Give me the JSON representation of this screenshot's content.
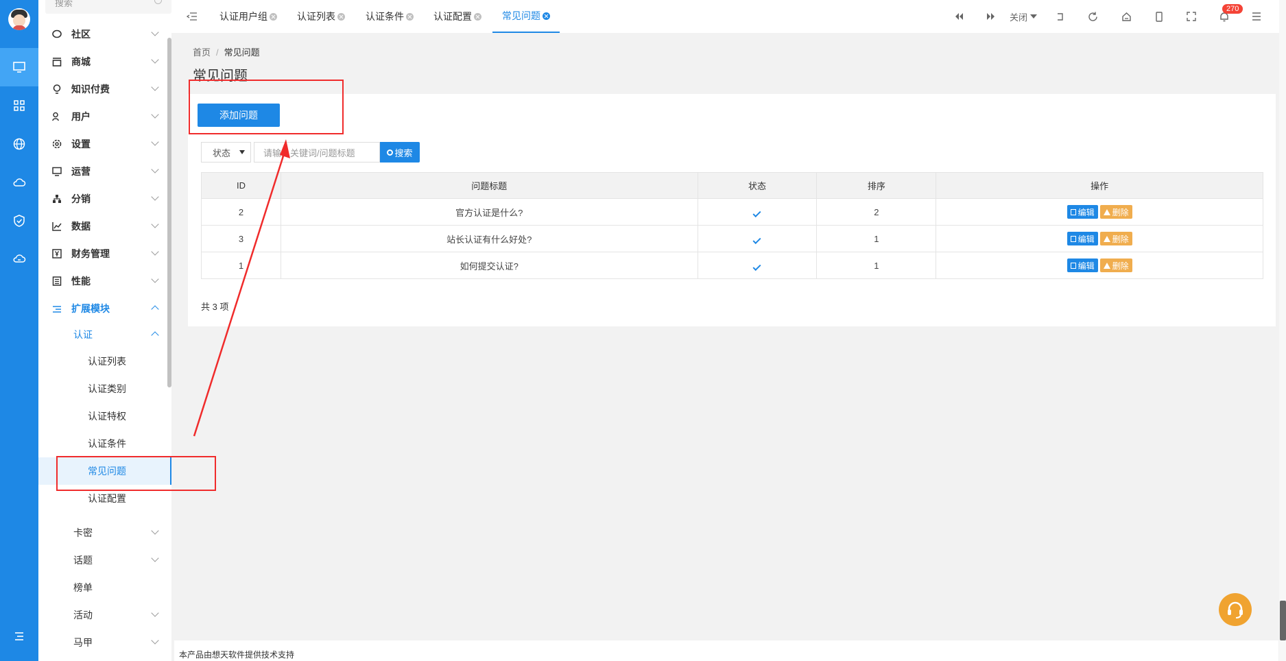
{
  "menu": {
    "search_placeholder": "搜索",
    "items": [
      {
        "label": "社区",
        "icon": "chat-icon"
      },
      {
        "label": "商城",
        "icon": "shop-icon"
      },
      {
        "label": "知识付费",
        "icon": "bulb-icon"
      },
      {
        "label": "用户",
        "icon": "users-icon"
      },
      {
        "label": "设置",
        "icon": "gear-icon"
      },
      {
        "label": "运营",
        "icon": "monitor-icon"
      },
      {
        "label": "分销",
        "icon": "network-icon"
      },
      {
        "label": "数据",
        "icon": "chart-icon"
      },
      {
        "label": "财务管理",
        "icon": "yen-icon"
      },
      {
        "label": "性能",
        "icon": "list-icon"
      },
      {
        "label": "扩展模块",
        "icon": "extension-icon"
      }
    ],
    "ext_group": "认证",
    "ext_children": [
      "认证列表",
      "认证类别",
      "认证特权",
      "认证条件",
      "常见问题",
      "认证配置"
    ],
    "more": [
      "卡密",
      "话题",
      "榜单",
      "活动",
      "马甲"
    ]
  },
  "tabs": [
    {
      "label": "认证用户组"
    },
    {
      "label": "认证列表"
    },
    {
      "label": "认证条件"
    },
    {
      "label": "认证配置"
    },
    {
      "label": "常见问题"
    }
  ],
  "topbar": {
    "close_label": "关闭",
    "notification_count": "270"
  },
  "breadcrumb": {
    "home": "首页",
    "sep": "/",
    "current": "常见问题"
  },
  "page_title": "常见问题",
  "toolbar": {
    "add_label": "添加问题",
    "status_label": "状态",
    "keyword_placeholder": "请输入关键词/问题标题",
    "search_label": "搜索"
  },
  "table": {
    "headers": [
      "ID",
      "问题标题",
      "状态",
      "排序",
      "操作"
    ],
    "rows": [
      {
        "id": "2",
        "title": "官方认证是什么?",
        "sort": "2"
      },
      {
        "id": "3",
        "title": "站长认证有什么好处?",
        "sort": "1"
      },
      {
        "id": "1",
        "title": "如何提交认证?",
        "sort": "1"
      }
    ],
    "edit_label": "编辑",
    "delete_label": "删除",
    "total": "共 3 项"
  },
  "footer": "本产品由想天软件提供技术支持",
  "colors": {
    "primary": "#1e88e5",
    "warning": "#f0ad4e",
    "annotation": "#f02b2b"
  }
}
